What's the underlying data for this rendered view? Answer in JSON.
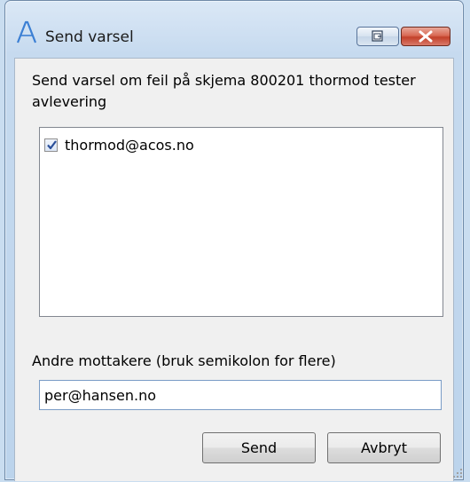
{
  "window": {
    "title": "Send varsel",
    "app_icon": "acos-logo-icon",
    "controls": {
      "restore_icon": "restore-icon",
      "close_icon": "close-icon"
    }
  },
  "dialog": {
    "message": "Send varsel om feil på skjema 800201 thormod tester avlevering",
    "recipients": [
      {
        "label": "thormod@acos.no",
        "checked": true
      }
    ],
    "other_recipients_label": "Andre mottakere (bruk semikolon for flere)",
    "other_recipients_value": "per@hansen.no",
    "send_label": "Send",
    "cancel_label": "Avbryt"
  },
  "colors": {
    "frame": "#c6daef",
    "client": "#f0f0f0",
    "close_button": "#c3412a",
    "accent_icon": "#3b7fd4"
  }
}
